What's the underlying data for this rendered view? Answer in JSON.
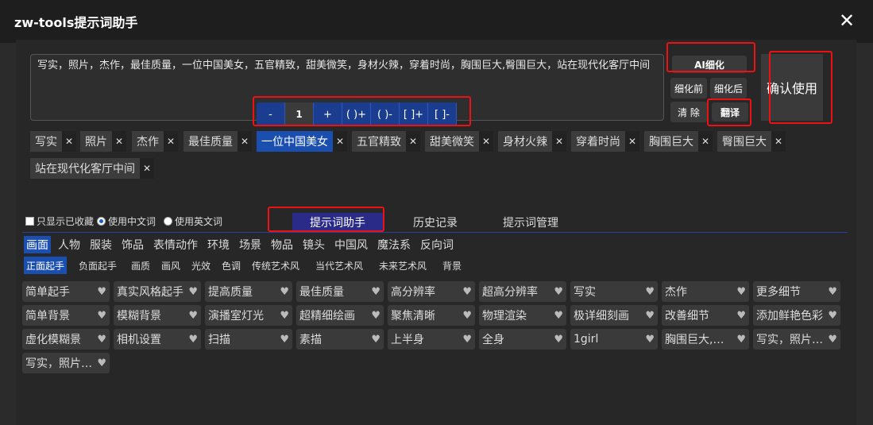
{
  "window": {
    "title": "zw-tools提示词助手",
    "close_icon": "✕"
  },
  "prompt_text": "写实，照片，杰作，最佳质量，一位中国美女，五官精致，甜美微笑，身材火辣，穿着时尚，胸围巨大,臀围巨大，站在现代化客厅中间",
  "weight_bar": {
    "minus": "-",
    "value": "1",
    "plus": "+",
    "paren_plus": "( )+",
    "paren_minus": "( )-",
    "bracket_plus": "[ ]+",
    "bracket_minus": "[ ]-"
  },
  "side_buttons": {
    "ai_refine": "AI细化",
    "before_refine": "细化前",
    "after_refine": "细化后",
    "clear": "清 除",
    "translate": "翻译",
    "confirm": "确认使用"
  },
  "tags": [
    "写实",
    "照片",
    "杰作",
    "最佳质量",
    "一位中国美女",
    "五官精致",
    "甜美微笑",
    "身材火辣",
    "穿着时尚",
    "胸围巨大",
    "臀围巨大",
    "站在现代化客厅中间"
  ],
  "options": {
    "only_favorites": "只显示已收藏",
    "use_chinese": "使用中文词",
    "use_english": "使用英文词"
  },
  "main_tabs": [
    "提示词助手",
    "历史记录",
    "提示词管理"
  ],
  "categories": [
    "画面",
    "人物",
    "服装",
    "饰品",
    "表情动作",
    "环境",
    "场景",
    "物品",
    "镜头",
    "中国风",
    "魔法系",
    "反向词"
  ],
  "subcategories": [
    "正面起手",
    "负面起手",
    "画质",
    "画风",
    "光效",
    "色调",
    "传统艺术风",
    "当代艺术风",
    "未来艺术风",
    "背景"
  ],
  "items": [
    "简单起手",
    "真实风格起手",
    "提高质量",
    "最佳质量",
    "高分辨率",
    "超高分辨率",
    "写实",
    "杰作",
    "更多细节",
    "简单背景",
    "模糊背景",
    "演播室灯光",
    "超精细绘画",
    "聚焦清晰",
    "物理渲染",
    "极详细刻画",
    "改善细节",
    "添加鲜艳色彩",
    "虚化模糊景",
    "相机设置",
    "扫描",
    "素描",
    "上半身",
    "全身",
    "1girl",
    "胸围巨大,…",
    "写实，照片…",
    "写实，照片…"
  ],
  "heart_icon": "♥"
}
